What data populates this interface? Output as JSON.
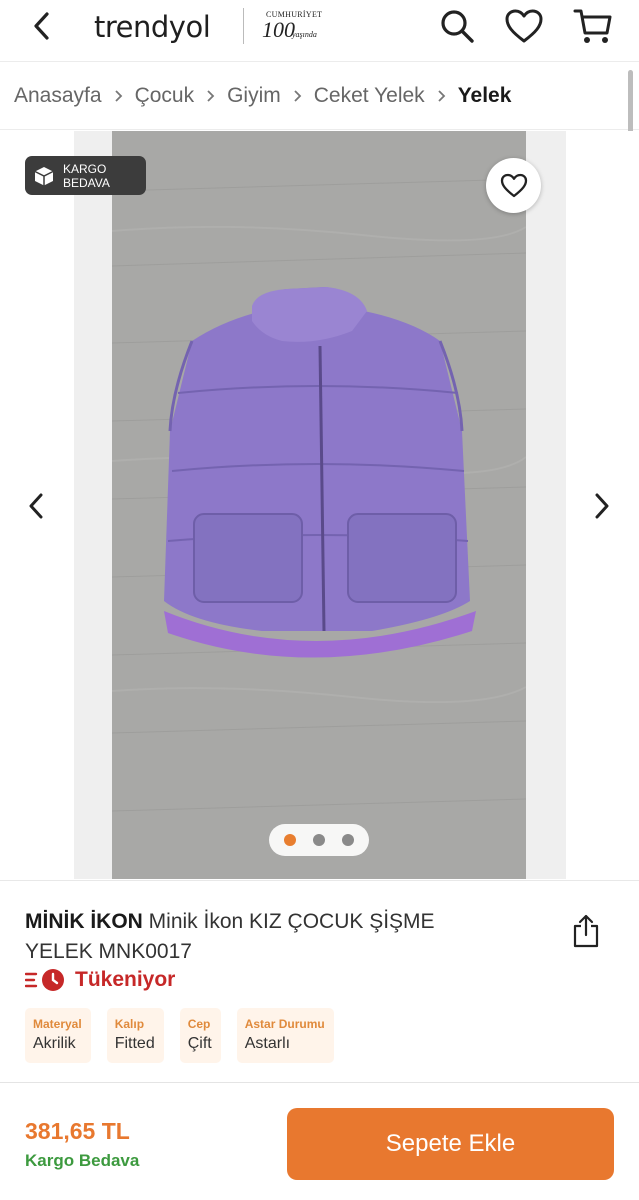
{
  "header": {
    "logo": "trendyol",
    "anniversary_top": "CUMHURİYET",
    "anniversary_num": "100",
    "anniversary_sub": "yaşında",
    "icons": [
      "back-icon",
      "search-icon",
      "heart-icon",
      "cart-icon"
    ]
  },
  "breadcrumb": {
    "items": [
      {
        "label": "Anasayfa"
      },
      {
        "label": "Çocuk"
      },
      {
        "label": "Giyim"
      },
      {
        "label": "Ceket Yelek"
      },
      {
        "label": "Yelek"
      }
    ]
  },
  "gallery": {
    "badge": "KARGO\nBEDAVA",
    "current_image": 1,
    "image_count": 3,
    "colors": {
      "vest": "#8d78c9",
      "lining": "#9f6fd4",
      "floor": "#a8a8a6"
    }
  },
  "product": {
    "brand": "MİNİK İKON",
    "name": "Minik İkon KIZ ÇOCUK ŞİŞME YELEK MNK0017",
    "stock_status": "Tükeniyor",
    "attributes": [
      {
        "key": "Materyal",
        "value": "Akrilik"
      },
      {
        "key": "Kalıp",
        "value": "Fitted"
      },
      {
        "key": "Cep",
        "value": "Çift"
      },
      {
        "key": "Astar Durumu",
        "value": "Astarlı"
      }
    ]
  },
  "purchase": {
    "price": "381,65 TL",
    "shipping": "Kargo Bedava",
    "add_to_cart": "Sepete Ekle"
  },
  "colors": {
    "accent": "#e8782f",
    "success": "#3d9a3f",
    "danger": "#c62828"
  }
}
